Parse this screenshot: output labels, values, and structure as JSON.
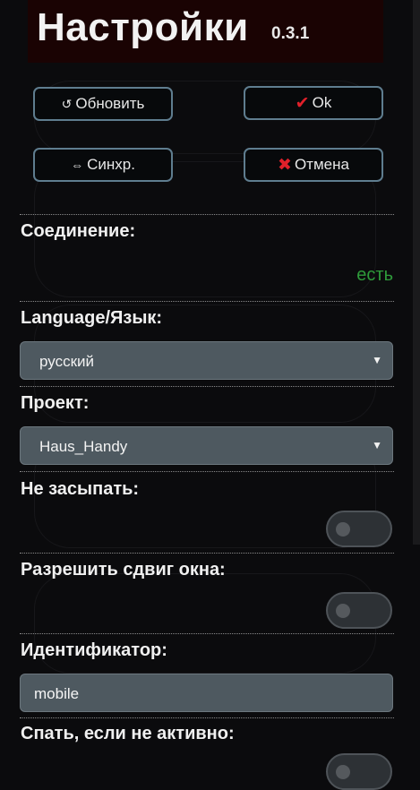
{
  "header": {
    "title": "Настройки",
    "version": "0.3.1"
  },
  "buttons": {
    "refresh": {
      "icon": "↺",
      "label": "Обновить"
    },
    "ok": {
      "icon": "✔",
      "label": "Ok"
    },
    "sync": {
      "icon": "⇔",
      "label": "Синхр."
    },
    "cancel": {
      "icon": "✖",
      "label": "Отмена"
    }
  },
  "connection": {
    "label": "Соединение:",
    "status": "есть",
    "status_color": "#2e9a3a"
  },
  "language": {
    "label": "Language/Язык:",
    "value": "русский",
    "arrow": "▼"
  },
  "project": {
    "label": "Проект:",
    "value": "Haus_Handy",
    "arrow": "▼"
  },
  "no_sleep": {
    "label": "Не засыпать:",
    "enabled": false
  },
  "allow_shift": {
    "label": "Разрешить сдвиг окна:",
    "enabled": false
  },
  "identifier": {
    "label": "Идентификатор:",
    "value": "mobile"
  },
  "sleep_inactive": {
    "label": "Спать, если не активно:"
  }
}
